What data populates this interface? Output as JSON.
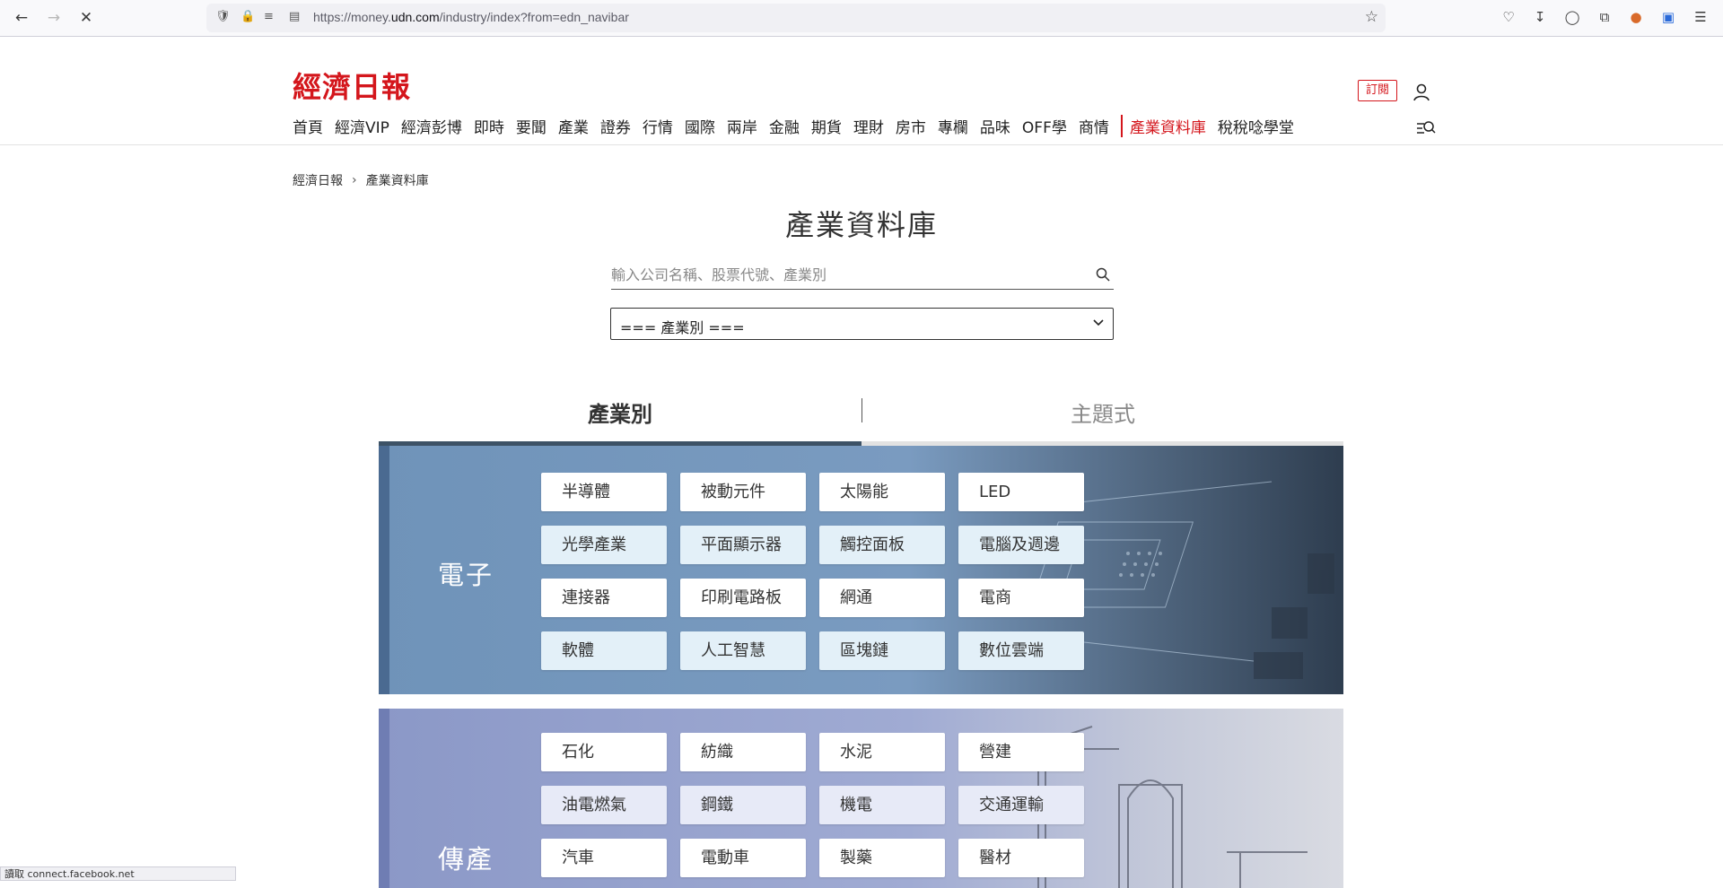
{
  "browser": {
    "url_prefix": "https://money.",
    "url_domain": "udn.com",
    "url_path": "/industry/index?from=edn_navibar",
    "status_text": "讀取 connect.facebook.net"
  },
  "site": {
    "logo_text": "經濟日報",
    "subscribe_label": "訂閱"
  },
  "nav": {
    "items": [
      "首頁",
      "經濟VIP",
      "經濟彭博",
      "即時",
      "要聞",
      "產業",
      "證券",
      "行情",
      "國際",
      "兩岸",
      "金融",
      "期貨",
      "理財",
      "房市",
      "專欄",
      "品味",
      "OFF學",
      "商情",
      "產業資料庫",
      "稅稅唸學堂"
    ]
  },
  "breadcrumb": {
    "home": "經濟日報",
    "current": "產業資料庫"
  },
  "page": {
    "title": "產業資料庫",
    "search_placeholder": "輸入公司名稱、股票代號、產業別",
    "select_value": "=== 產業別 ==="
  },
  "tabs": [
    "產業別",
    "主題式"
  ],
  "colors": {
    "brand_red": "#d4161c",
    "tab_active": "#3d5266"
  },
  "panels": [
    {
      "category": "電子",
      "tags": [
        "半導體",
        "被動元件",
        "太陽能",
        "LED",
        "光學產業",
        "平面顯示器",
        "觸控面板",
        "電腦及週邊",
        "連接器",
        "印刷電路板",
        "網通",
        "電商",
        "軟體",
        "人工智慧",
        "區塊鏈",
        "數位雲端"
      ]
    },
    {
      "category": "傳產",
      "tags": [
        "石化",
        "紡織",
        "水泥",
        "營建",
        "油電燃氣",
        "鋼鐵",
        "機電",
        "交通運輸",
        "汽車",
        "電動車",
        "製藥",
        "醫材"
      ]
    }
  ]
}
